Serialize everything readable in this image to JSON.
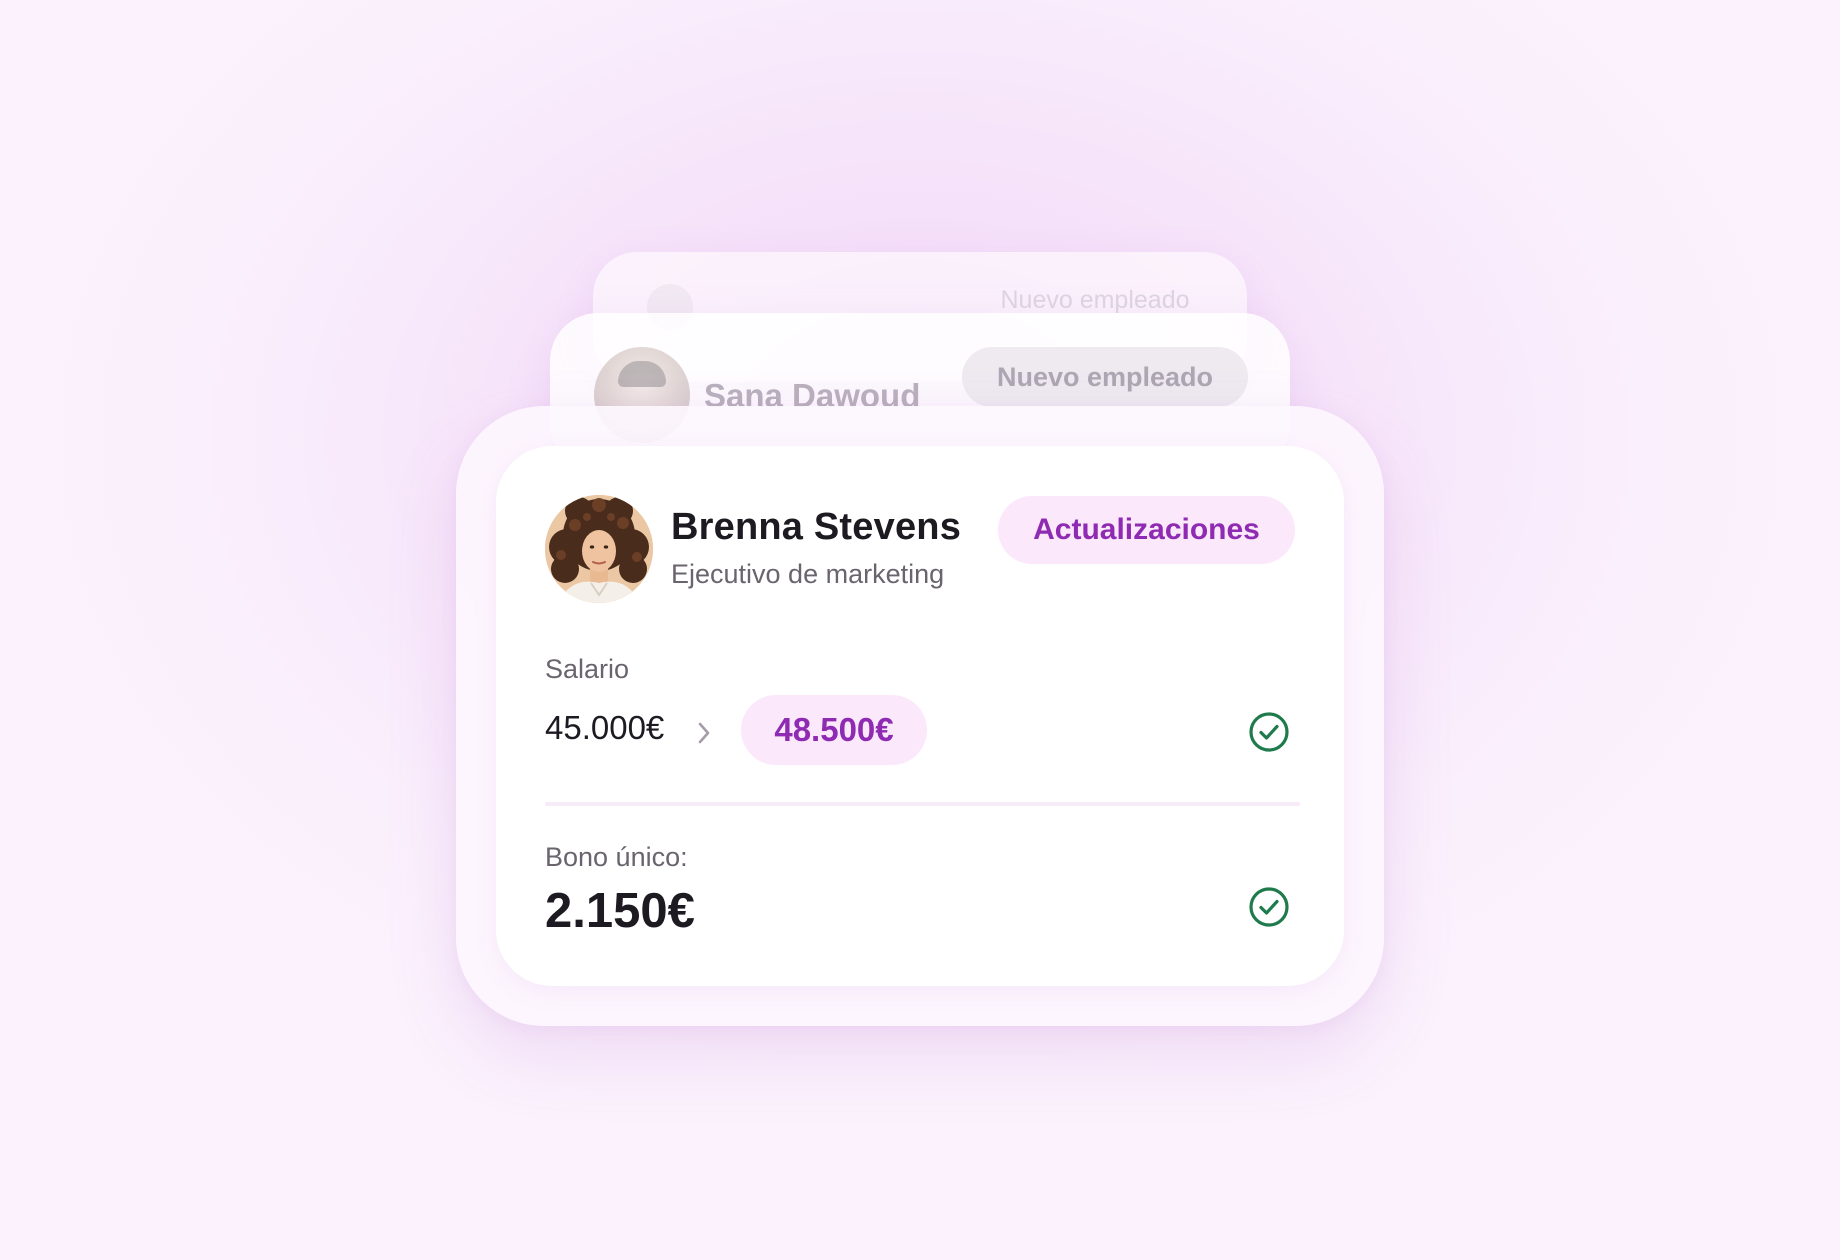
{
  "back_cards": {
    "far": {
      "name": "",
      "badge": "Nuevo empleado"
    },
    "near": {
      "name": "Sana Dawoud",
      "badge": "Nuevo empleado"
    }
  },
  "employee": {
    "name": "Brenna Stevens",
    "role": "Ejecutivo de marketing",
    "badge": "Actualizaciones"
  },
  "salary": {
    "label": "Salario",
    "old_value": "45.000€",
    "new_value": "48.500€",
    "status_icon": "check-circle-icon"
  },
  "bonus": {
    "label": "Bono único:",
    "value": "2.150€",
    "status_icon": "check-circle-icon"
  },
  "colors": {
    "accent": "#8e2bb2",
    "accent_bg": "#fbe9fb",
    "success": "#1f7a4c",
    "text_primary": "#1e1a22",
    "text_secondary": "#6a646e"
  }
}
